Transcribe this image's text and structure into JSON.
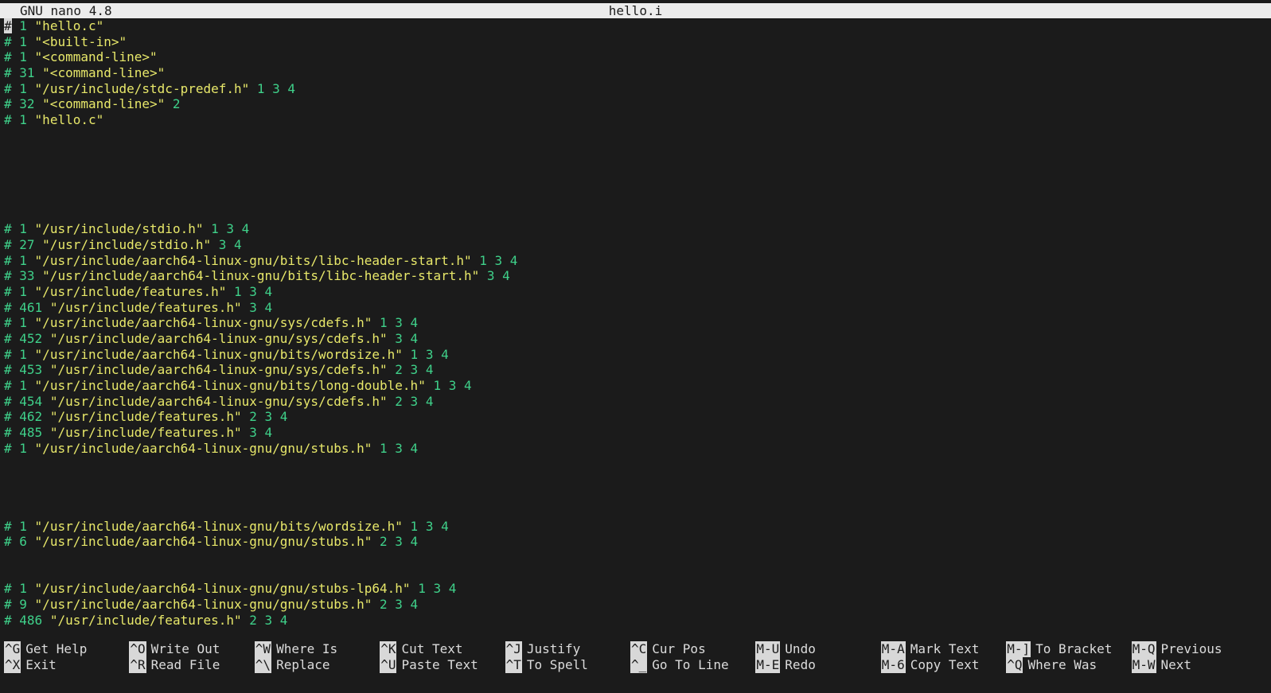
{
  "titlebar": {
    "app_name": "GNU nano 4.8",
    "file_name": "hello.i"
  },
  "buffer": {
    "lines": [
      {
        "row": 0,
        "num": "1",
        "str": "\"hello.c\"",
        "flags": ""
      },
      {
        "row": 1,
        "num": "1",
        "str": "\"<built-in>\"",
        "flags": ""
      },
      {
        "row": 2,
        "num": "1",
        "str": "\"<command-line>\"",
        "flags": ""
      },
      {
        "row": 3,
        "num": "31",
        "str": "\"<command-line>\"",
        "flags": ""
      },
      {
        "row": 4,
        "num": "1",
        "str": "\"/usr/include/stdc-predef.h\"",
        "flags": "1 3 4"
      },
      {
        "row": 5,
        "num": "32",
        "str": "\"<command-line>\"",
        "flags": "2"
      },
      {
        "row": 6,
        "num": "1",
        "str": "\"hello.c\"",
        "flags": ""
      },
      {
        "row": 13,
        "num": "1",
        "str": "\"/usr/include/stdio.h\"",
        "flags": "1 3 4"
      },
      {
        "row": 14,
        "num": "27",
        "str": "\"/usr/include/stdio.h\"",
        "flags": "3 4"
      },
      {
        "row": 15,
        "num": "1",
        "str": "\"/usr/include/aarch64-linux-gnu/bits/libc-header-start.h\"",
        "flags": "1 3 4"
      },
      {
        "row": 16,
        "num": "33",
        "str": "\"/usr/include/aarch64-linux-gnu/bits/libc-header-start.h\"",
        "flags": "3 4"
      },
      {
        "row": 17,
        "num": "1",
        "str": "\"/usr/include/features.h\"",
        "flags": "1 3 4"
      },
      {
        "row": 18,
        "num": "461",
        "str": "\"/usr/include/features.h\"",
        "flags": "3 4"
      },
      {
        "row": 19,
        "num": "1",
        "str": "\"/usr/include/aarch64-linux-gnu/sys/cdefs.h\"",
        "flags": "1 3 4"
      },
      {
        "row": 20,
        "num": "452",
        "str": "\"/usr/include/aarch64-linux-gnu/sys/cdefs.h\"",
        "flags": "3 4"
      },
      {
        "row": 21,
        "num": "1",
        "str": "\"/usr/include/aarch64-linux-gnu/bits/wordsize.h\"",
        "flags": "1 3 4"
      },
      {
        "row": 22,
        "num": "453",
        "str": "\"/usr/include/aarch64-linux-gnu/sys/cdefs.h\"",
        "flags": "2 3 4"
      },
      {
        "row": 23,
        "num": "1",
        "str": "\"/usr/include/aarch64-linux-gnu/bits/long-double.h\"",
        "flags": "1 3 4"
      },
      {
        "row": 24,
        "num": "454",
        "str": "\"/usr/include/aarch64-linux-gnu/sys/cdefs.h\"",
        "flags": "2 3 4"
      },
      {
        "row": 25,
        "num": "462",
        "str": "\"/usr/include/features.h\"",
        "flags": "2 3 4"
      },
      {
        "row": 26,
        "num": "485",
        "str": "\"/usr/include/features.h\"",
        "flags": "3 4"
      },
      {
        "row": 27,
        "num": "1",
        "str": "\"/usr/include/aarch64-linux-gnu/gnu/stubs.h\"",
        "flags": "1 3 4"
      },
      {
        "row": 32,
        "num": "1",
        "str": "\"/usr/include/aarch64-linux-gnu/bits/wordsize.h\"",
        "flags": "1 3 4"
      },
      {
        "row": 33,
        "num": "6",
        "str": "\"/usr/include/aarch64-linux-gnu/gnu/stubs.h\"",
        "flags": "2 3 4"
      },
      {
        "row": 36,
        "num": "1",
        "str": "\"/usr/include/aarch64-linux-gnu/gnu/stubs-lp64.h\"",
        "flags": "1 3 4"
      },
      {
        "row": 37,
        "num": "9",
        "str": "\"/usr/include/aarch64-linux-gnu/gnu/stubs.h\"",
        "flags": "2 3 4"
      },
      {
        "row": 38,
        "num": "486",
        "str": "\"/usr/include/features.h\"",
        "flags": "2 3 4"
      }
    ]
  },
  "shortcuts": [
    {
      "col": 0,
      "row": 0,
      "key": "^G",
      "label": "Get Help",
      "name": "shortcut-get-help"
    },
    {
      "col": 0,
      "row": 1,
      "key": "^X",
      "label": "Exit",
      "name": "shortcut-exit"
    },
    {
      "col": 1,
      "row": 0,
      "key": "^O",
      "label": "Write Out",
      "name": "shortcut-write-out"
    },
    {
      "col": 1,
      "row": 1,
      "key": "^R",
      "label": "Read File",
      "name": "shortcut-read-file"
    },
    {
      "col": 2,
      "row": 0,
      "key": "^W",
      "label": "Where Is",
      "name": "shortcut-where-is"
    },
    {
      "col": 2,
      "row": 1,
      "key": "^\\",
      "label": "Replace",
      "name": "shortcut-replace"
    },
    {
      "col": 3,
      "row": 0,
      "key": "^K",
      "label": "Cut Text",
      "name": "shortcut-cut-text"
    },
    {
      "col": 3,
      "row": 1,
      "key": "^U",
      "label": "Paste Text",
      "name": "shortcut-paste-text"
    },
    {
      "col": 4,
      "row": 0,
      "key": "^J",
      "label": "Justify",
      "name": "shortcut-justify"
    },
    {
      "col": 4,
      "row": 1,
      "key": "^T",
      "label": "To Spell",
      "name": "shortcut-to-spell"
    },
    {
      "col": 5,
      "row": 0,
      "key": "^C",
      "label": "Cur Pos",
      "name": "shortcut-cur-pos"
    },
    {
      "col": 5,
      "row": 1,
      "key": "^_",
      "label": "Go To Line",
      "name": "shortcut-go-to-line"
    },
    {
      "col": 6,
      "row": 0,
      "key": "M-U",
      "label": "Undo",
      "name": "shortcut-undo"
    },
    {
      "col": 6,
      "row": 1,
      "key": "M-E",
      "label": "Redo",
      "name": "shortcut-redo"
    },
    {
      "col": 7,
      "row": 0,
      "key": "M-A",
      "label": "Mark Text",
      "name": "shortcut-mark-text"
    },
    {
      "col": 7,
      "row": 1,
      "key": "M-6",
      "label": "Copy Text",
      "name": "shortcut-copy-text"
    },
    {
      "col": 8,
      "row": 0,
      "key": "M-]",
      "label": "To Bracket",
      "name": "shortcut-to-bracket"
    },
    {
      "col": 8,
      "row": 1,
      "key": "^Q",
      "label": "Where Was",
      "name": "shortcut-where-was"
    },
    {
      "col": 9,
      "row": 0,
      "key": "M-Q",
      "label": "Previous",
      "name": "shortcut-previous"
    },
    {
      "col": 9,
      "row": 1,
      "key": "M-W",
      "label": "Next",
      "name": "shortcut-next"
    }
  ]
}
